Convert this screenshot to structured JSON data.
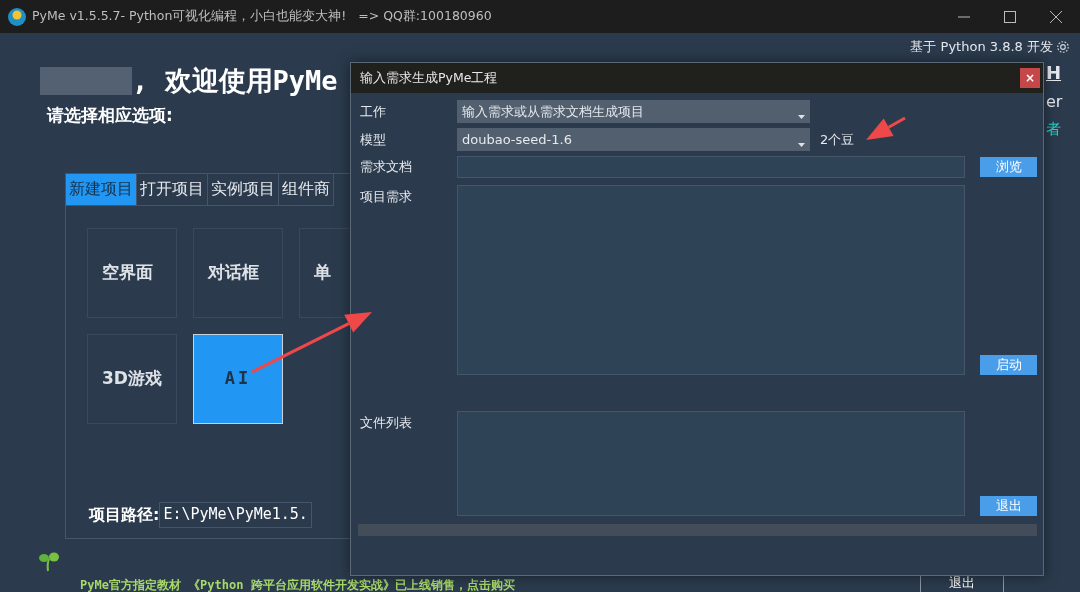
{
  "window": {
    "title": "PyMe v1.5.5.7- Python可视化编程，小白也能变大神!   => QQ群:100180960"
  },
  "header": {
    "based_on": "基于 Python 3.8.8 开发",
    "welcome": ", 欢迎使用PyMe",
    "prompt": "请选择相应选项:",
    "side_fragments": [
      {
        "text": "H",
        "kind": "link"
      },
      {
        "text": "er",
        "kind": "plain"
      },
      {
        "text": "者",
        "kind": "accent"
      }
    ]
  },
  "tabs": [
    {
      "label": "新建项目",
      "selected": true
    },
    {
      "label": "打开项目",
      "selected": false
    },
    {
      "label": "实例项目",
      "selected": false
    },
    {
      "label": "组件商",
      "selected": false
    }
  ],
  "tiles": [
    {
      "label": "空界面",
      "selected": false
    },
    {
      "label": "对话框",
      "selected": false
    },
    {
      "label": "单",
      "selected": false
    },
    {
      "label": "3D游戏",
      "selected": false
    },
    {
      "label": "AI",
      "selected": true
    }
  ],
  "project_path": {
    "label": "项目路径:",
    "value": "E:\\PyMe\\PyMe1.5."
  },
  "footer": {
    "promo": "PyMe官方指定教材 《Python 跨平台应用软件开发实战》已上线销售，点击购买",
    "exit": "退出"
  },
  "dialog": {
    "title": "输入需求生成PyMe工程",
    "close": "×",
    "work": {
      "label": "工作",
      "value": "输入需求或从需求文档生成项目"
    },
    "model": {
      "label": "模型",
      "value": "doubao-seed-1.6",
      "cost": "2个豆"
    },
    "doc": {
      "label": "需求文档",
      "button": "浏览"
    },
    "requirements": {
      "label": "项目需求",
      "button": "启动"
    },
    "files": {
      "label": "文件列表",
      "button": "退出"
    }
  }
}
